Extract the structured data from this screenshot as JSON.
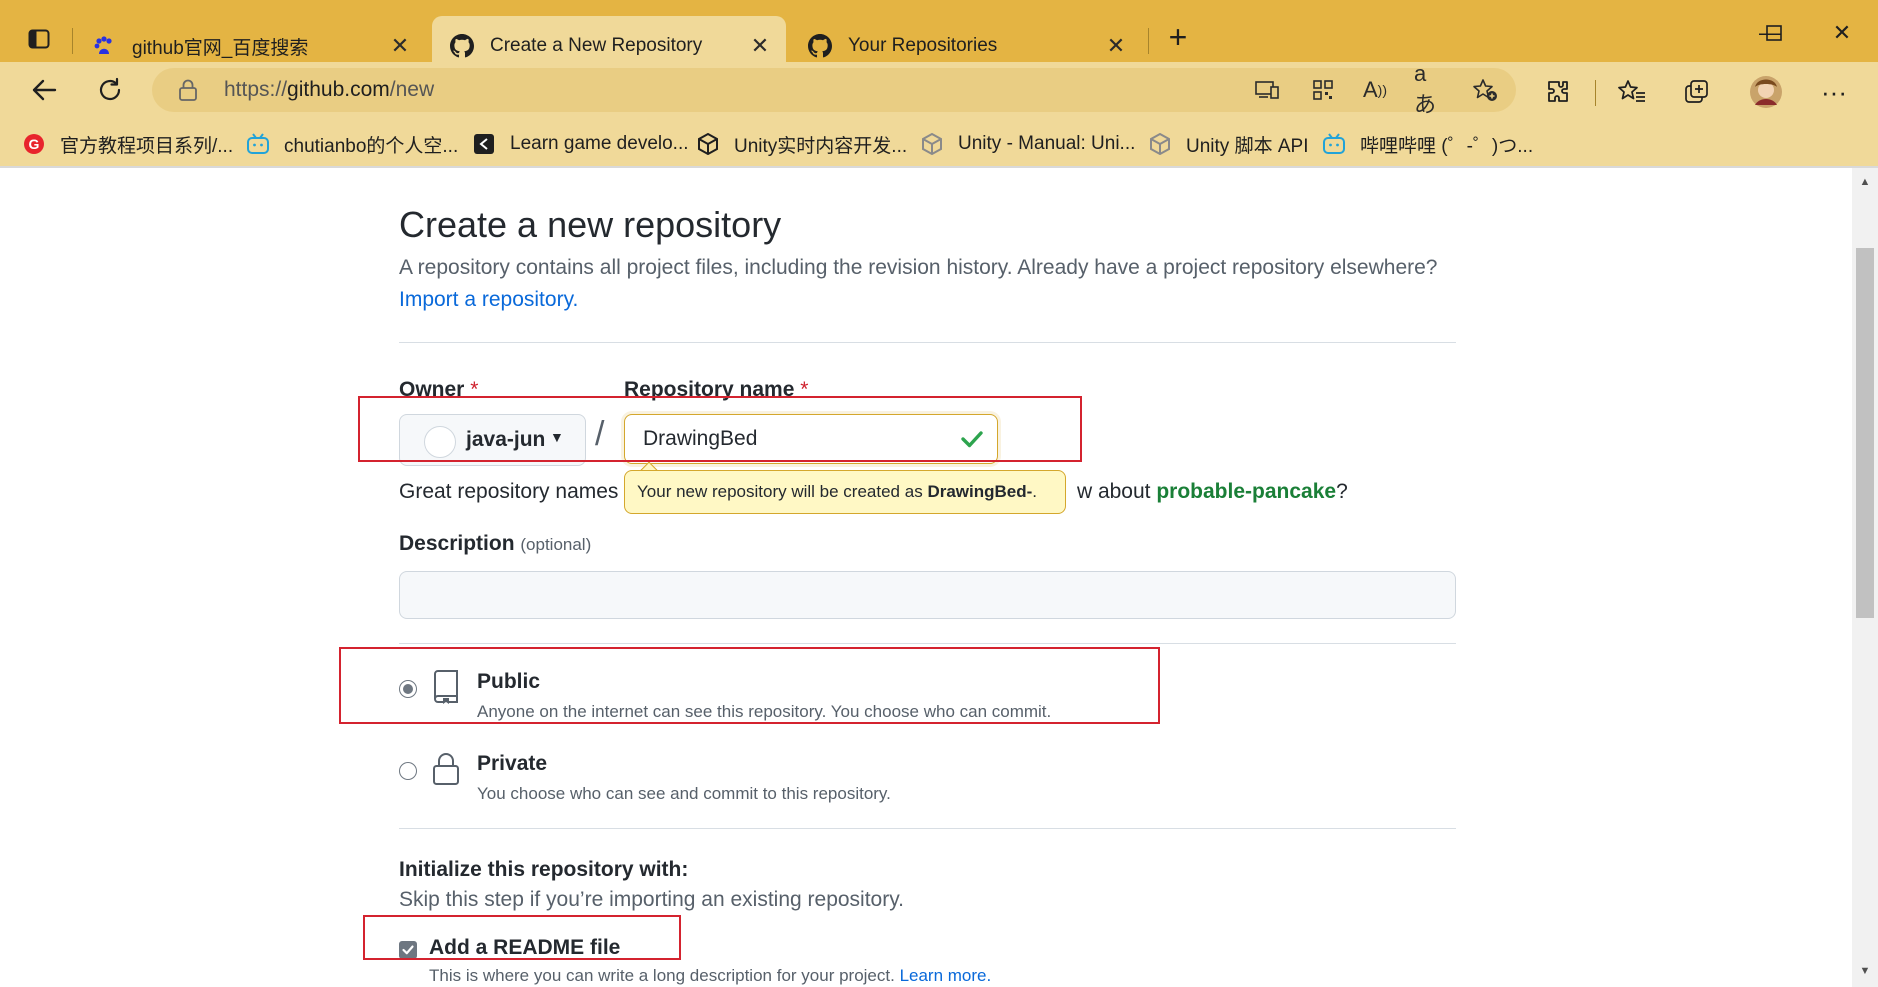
{
  "browser": {
    "tabs": [
      {
        "title": "github官网_百度搜索",
        "icon": "baidu-paw-icon"
      },
      {
        "title": "Create a New Repository",
        "icon": "github-icon"
      },
      {
        "title": "Your Repositories",
        "icon": "github-icon"
      }
    ],
    "url_prefix": "https://",
    "url_host": "github.com",
    "url_path": "/new",
    "bookmarks": [
      {
        "label": "官方教程项目系列/...",
        "icon": "red-g-icon"
      },
      {
        "label": "chutianbo的个人空...",
        "icon": "bilibili-icon"
      },
      {
        "label": "Learn game develo...",
        "icon": "unity-learn-icon"
      },
      {
        "label": "Unity实时内容开发...",
        "icon": "unity-icon"
      },
      {
        "label": "Unity - Manual: Uni...",
        "icon": "unity-icon"
      },
      {
        "label": "Unity 脚本 API",
        "icon": "unity-icon"
      },
      {
        "label": "哔哩哔哩 (゜-゜)つ...",
        "icon": "bilibili-icon"
      }
    ],
    "colors": {
      "frame": "#e4b443",
      "toolbar": "#f0d999"
    }
  },
  "page": {
    "title": "Create a new repository",
    "subtitle": "A repository contains all project files, including the revision history. Already have a project repository elsewhere?",
    "import_link": "Import a repository.",
    "owner_label": "Owner",
    "repo_name_label": "Repository name",
    "required_mark": "*",
    "owner_value": "java-jun",
    "slash": "/",
    "repo_name_value": "DrawingBed",
    "great_prefix": "Great repository names a",
    "great_suffix": "w about",
    "suggestion": "probable-pancake",
    "question_mark": "?",
    "tooltip_prefix": "Your new repository will be created as",
    "tooltip_name": "DrawingBed-",
    "tooltip_suffix": ".",
    "description_label": "Description",
    "optional_label": "(optional)",
    "description_value": "",
    "public_title": "Public",
    "public_desc": "Anyone on the internet can see this repository. You choose who can commit.",
    "private_title": "Private",
    "private_desc": "You choose who can see and commit to this repository.",
    "visibility_selected": "Public",
    "init_title": "Initialize this repository with:",
    "init_sub": "Skip this step if you’re importing an existing repository.",
    "readme_label": "Add a README file",
    "readme_checked": true,
    "readme_desc": "This is where you can write a long description for your project.",
    "learn_more": "Learn more."
  }
}
